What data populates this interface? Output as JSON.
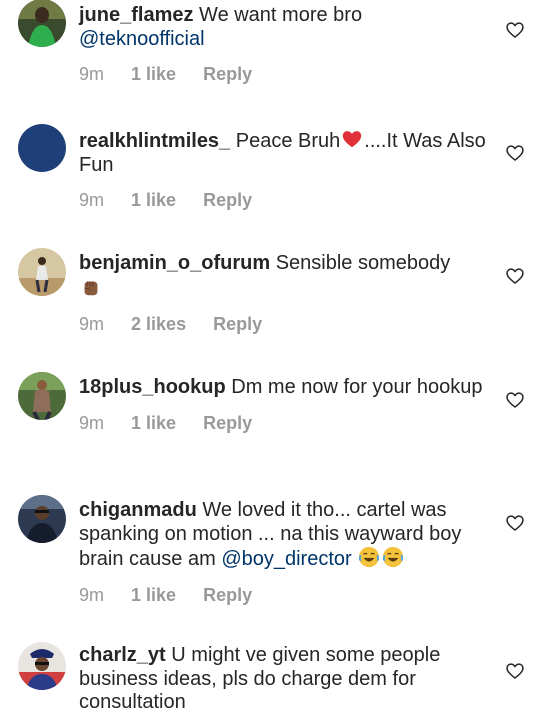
{
  "comments": [
    {
      "username": "june_flamez",
      "text": "We want more bro",
      "mention": "@teknoofficial",
      "time": "9m",
      "likes": "1 like",
      "reply": "Reply"
    },
    {
      "username": "realkhlintmiles_",
      "text": "Peace Bruh",
      "text_after": "....It Was Also Fun",
      "time": "9m",
      "likes": "1 like",
      "reply": "Reply"
    },
    {
      "username": "benjamin_o_ofurum",
      "text": "Sensible somebody",
      "time": "9m",
      "likes": "2 likes",
      "reply": "Reply"
    },
    {
      "username": "18plus_hookup",
      "text": "Dm me now for your hookup",
      "time": "9m",
      "likes": "1 like",
      "reply": "Reply"
    },
    {
      "username": "chiganmadu",
      "text": "We loved it tho... cartel was spanking on motion ... na this wayward boy brain cause am",
      "mention": "@boy_director",
      "time": "9m",
      "likes": "1 like",
      "reply": "Reply"
    },
    {
      "username": "charlz_yt",
      "text": "U might ve given some people business ideas, pls do charge dem for consultation"
    }
  ],
  "icons": {
    "like": "heart-outline-icon",
    "heart_emoji": "red-heart-emoji",
    "fist_emoji": "raised-fist-emoji",
    "laugh_emoji": "tears-of-joy-emoji"
  },
  "colors": {
    "text": "#262626",
    "meta": "#999999",
    "mention": "#003569"
  }
}
